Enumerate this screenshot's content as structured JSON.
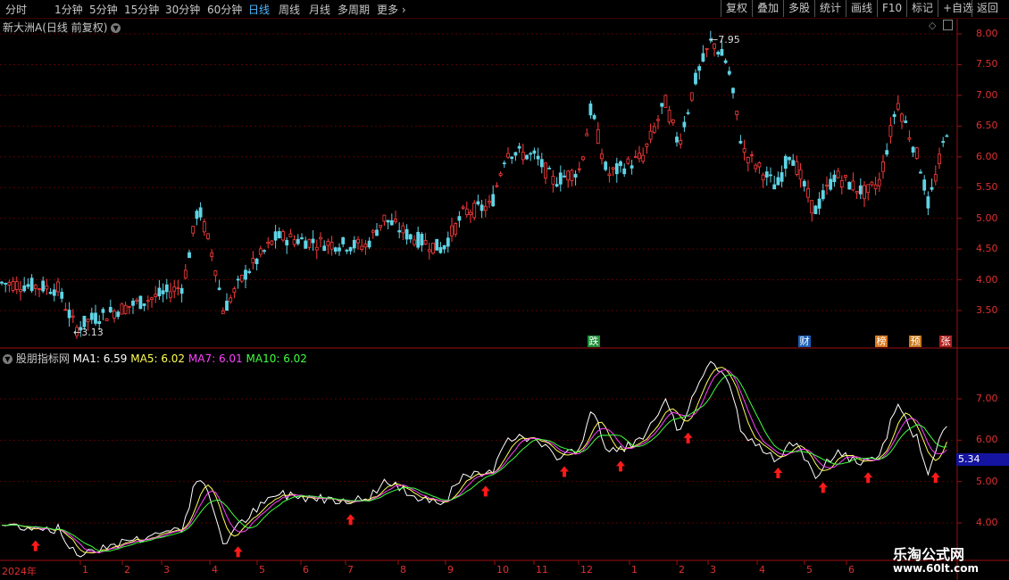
{
  "toolbar": {
    "periods": [
      "分时",
      "1分钟",
      "5分钟",
      "15分钟",
      "30分钟",
      "60分钟",
      "日线",
      "周线",
      "月线",
      "多周期",
      "更多"
    ],
    "active_period": "日线",
    "tools": [
      "复权",
      "叠加",
      "多股",
      "统计",
      "画线",
      "F10",
      "标记",
      "+自选",
      "返回"
    ]
  },
  "price_panel": {
    "title": "新大洲A(日线 前复权)",
    "high_label": "7.95",
    "low_label": "3.13",
    "axis_ticks": [
      "8.00",
      "7.50",
      "7.00",
      "6.50",
      "6.00",
      "5.50",
      "5.00",
      "4.50",
      "4.00",
      "3.50"
    ],
    "events": [
      {
        "text": "跌",
        "color": "#1e8f3a"
      },
      {
        "text": "财",
        "color": "#1a5fb4"
      },
      {
        "text": "榜",
        "color": "#d9771a"
      },
      {
        "text": "预",
        "color": "#c8781a"
      },
      {
        "text": "张",
        "color": "#b02020"
      }
    ],
    "colors": {
      "up": "#ff3c3c",
      "down": "#5fd4e6"
    }
  },
  "indicator_panel": {
    "name": "股朋指标网",
    "ma1": {
      "label": "MA1: 6.59",
      "color": "#ffffff"
    },
    "ma5": {
      "label": "MA5: 6.02",
      "color": "#ffff55"
    },
    "ma7": {
      "label": "MA7: 6.01",
      "color": "#ff40ff"
    },
    "ma10": {
      "label": "MA10: 6.02",
      "color": "#40ff40"
    },
    "axis_ticks": [
      "7.00",
      "6.00",
      "5.00",
      "4.00"
    ],
    "current_price": "5.34"
  },
  "xaxis": {
    "year_label": "2024年",
    "months": [
      "1",
      "2",
      "3",
      "4",
      "5",
      "6",
      "7",
      "8",
      "9",
      "10",
      "11",
      "12",
      "1",
      "2",
      "3",
      "4",
      "5",
      "6"
    ]
  },
  "watermark": {
    "line1": "乐淘公式网",
    "line2": "www.60lt.com"
  }
}
